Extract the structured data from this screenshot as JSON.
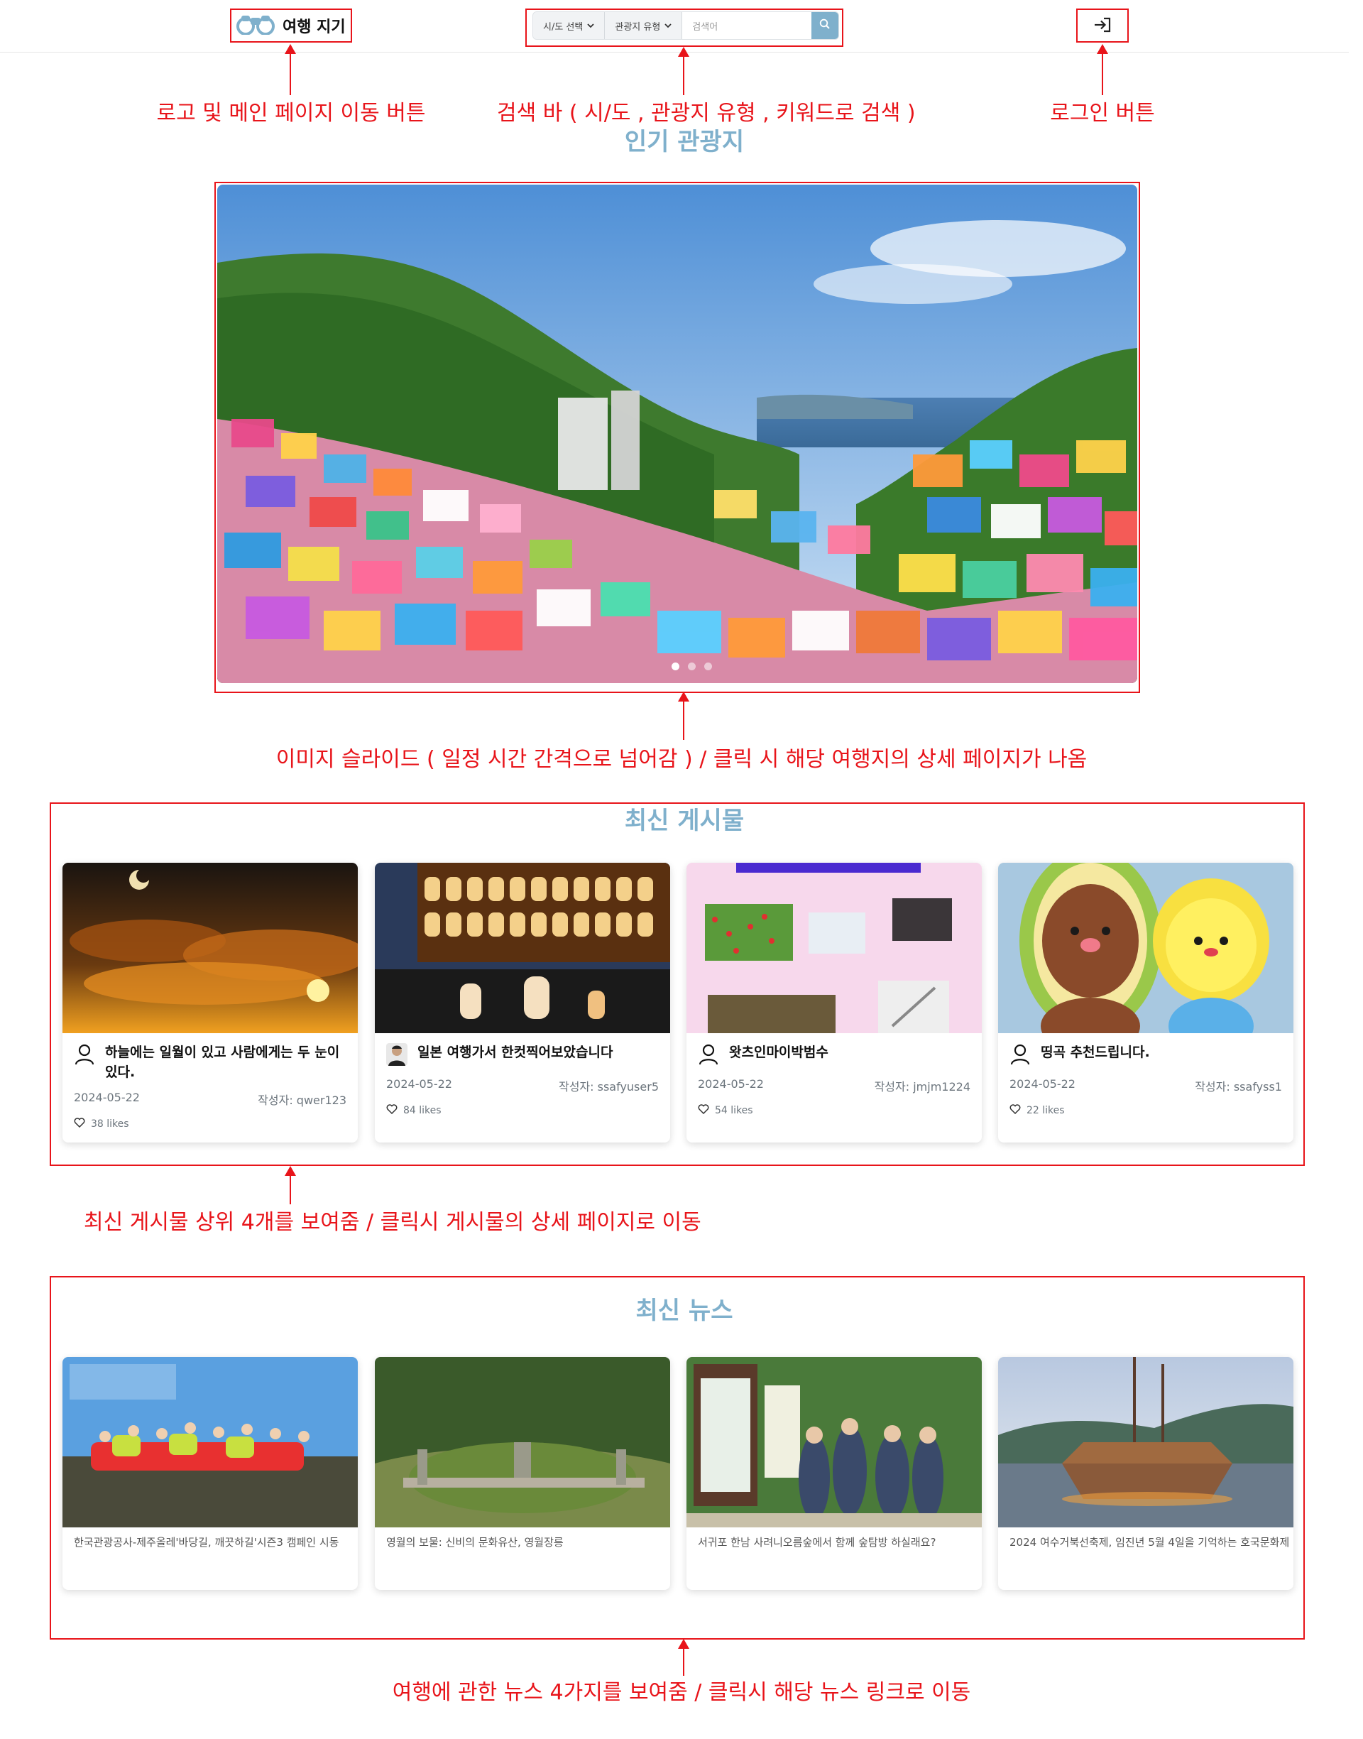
{
  "header": {
    "logo_text": "여행 지기",
    "search": {
      "sido_label": "시/도 선택",
      "type_label": "관광지 유형",
      "placeholder": "검색어"
    }
  },
  "annotations": {
    "logo": "로고 및 메인 페이지 이동 버튼",
    "search": "검색 바 ( 시/도 , 관광지 유형 , 키워드로 검색 )",
    "login": "로그인 버튼",
    "slider": "이미지 슬라이드 ( 일정 시간 간격으로 넘어감 ) / 클릭 시 해당 여행지의 상세 페이지가 나옴",
    "posts": "최신 게시물 상위 4개를 보여줌 / 클릭시 게시물의 상세 페이지로 이동",
    "news": "여행에 관한 뉴스 4가지를 보여줌 / 클릭시 해당 뉴스 링크로 이동"
  },
  "popular": {
    "title": "인기 관광지"
  },
  "posts_section": {
    "title": "최신 게시물",
    "items": [
      {
        "title": "하늘에는 일월이 있고 사람에게는 두 눈이 있다.",
        "date": "2024-05-22",
        "author": "작성자: qwer123",
        "likes": "38 likes"
      },
      {
        "title": "일본 여행가서 한컷찍어보았습니다",
        "date": "2024-05-22",
        "author": "작성자: ssafyuser5",
        "likes": "84 likes"
      },
      {
        "title": "왓츠인마이박범수",
        "date": "2024-05-22",
        "author": "작성자: jmjm1224",
        "likes": "54 likes"
      },
      {
        "title": "띵곡 추천드립니다.",
        "date": "2024-05-22",
        "author": "작성자: ssafyss1",
        "likes": "22 likes"
      }
    ]
  },
  "news_section": {
    "title": "최신 뉴스",
    "items": [
      {
        "title": "한국관광공사-제주올레'바당길, 깨끗하길'시즌3 캠페인 시동"
      },
      {
        "title": "영월의 보물: 신비의 문화유산, 영월장릉"
      },
      {
        "title": "서귀포 한남 사려니오름숲에서 함께 숲탐방 하실래요?"
      },
      {
        "title": "2024 여수거북선축제, 임진년 5월 4일을 기억하는 호국문화제"
      }
    ]
  },
  "colors": {
    "accent": "#7fb0cc",
    "annotation": "#e8141a"
  }
}
